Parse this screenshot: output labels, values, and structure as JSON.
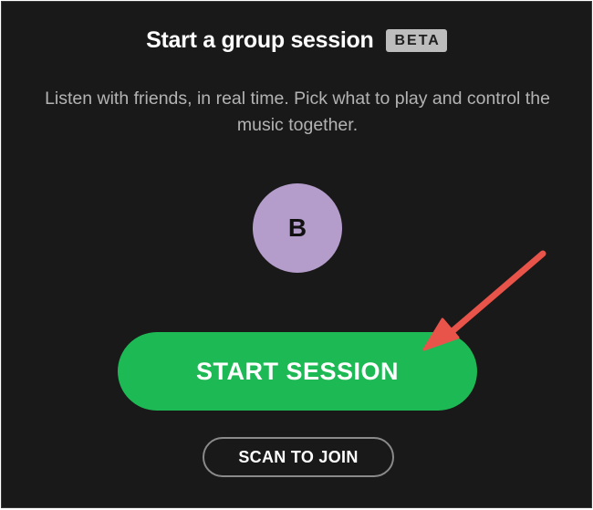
{
  "session": {
    "title": "Start a group session",
    "badge": "BETA",
    "description": "Listen with friends, in real time. Pick what to play and control the music together."
  },
  "avatar": {
    "initial": "B",
    "color": "#b49ccb"
  },
  "actions": {
    "start_label": "START SESSION",
    "scan_label": "SCAN TO JOIN"
  },
  "colors": {
    "background": "#191919",
    "accent": "#1db954",
    "annotation": "#e8534a"
  }
}
